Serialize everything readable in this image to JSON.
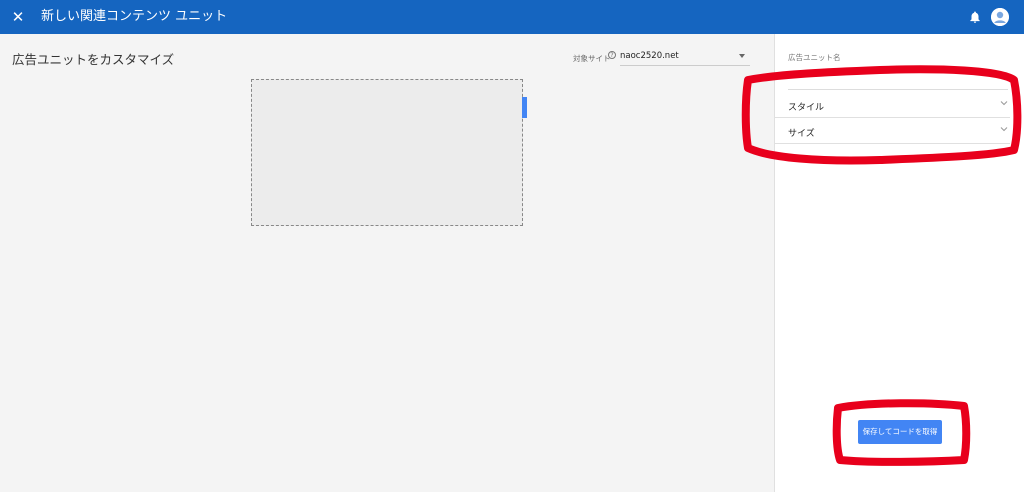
{
  "header": {
    "close_icon": "close-icon",
    "title": "新しい関連コンテンツ ユニット",
    "bell_icon": "bell-icon",
    "avatar_icon": "account-circle-icon"
  },
  "main": {
    "title": "広告ユニットをカスタマイズ",
    "site_label": "対象サイト",
    "help_icon": "help-icon",
    "site_value": "naoc2520.net"
  },
  "panel": {
    "name_label": "広告ユニット名",
    "name_value": "",
    "sections": [
      {
        "label": "スタイル",
        "icon": "chevron-down-icon"
      },
      {
        "label": "サイズ",
        "icon": "chevron-down-icon"
      }
    ],
    "save_button": "保存してコードを取得"
  },
  "colors": {
    "topbar": "#1565c0",
    "accent": "#4285f4",
    "annotation": "#e8001c"
  }
}
